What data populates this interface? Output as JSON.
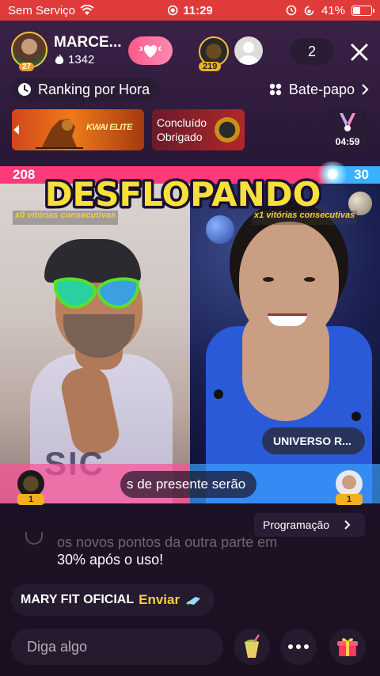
{
  "status_bar": {
    "carrier": "Sem Serviço",
    "time": "11:29",
    "battery": "41%",
    "battery_level": 0.41
  },
  "header": {
    "host_name": "MARCE...",
    "host_level": "27",
    "host_score": "1342",
    "viewer1_badge": "219",
    "viewer_count": "2"
  },
  "nav": {
    "ranking_label": "Ranking por Hora",
    "chat_label": "Bate-papo"
  },
  "banners": {
    "kwai_elite": "KWAI ELITE",
    "done_line1": "Concluído",
    "done_line2": "Obrigado",
    "pk_timer": "04:59"
  },
  "pk": {
    "left_score": "208",
    "right_score": "30",
    "left_share": 0.874,
    "title": "DESFLOPANDO",
    "left_streak": "x0 vitórias consecutivas",
    "right_streak": "x1 vitórias consecutivas",
    "left_shirt_print": "SIC",
    "opponent_name": "UNIVERSO R...",
    "left_rank": "1",
    "right_rank": "1",
    "ticker_text": "s de presente serão",
    "colors": {
      "left": "#ff3a7a",
      "right": "#3ab0ff",
      "title_fill": "#f6e03a"
    }
  },
  "chat": {
    "programacao_label": "Programação",
    "message_faded": "os novos pontos da outra parte em",
    "message_main": "30% após o uso!",
    "gift_user": "MARY FIT OFICIAL",
    "gift_send": "Enviar"
  },
  "input": {
    "placeholder": "Diga algo"
  },
  "icons": {
    "wifi": "wifi-icon",
    "lock_rotation": "rotation-lock-icon",
    "heart": "heart-wings-icon",
    "close": "close-icon",
    "clock": "clock-icon",
    "chat_grid": "chat-grid-icon",
    "chevron": "chevron-right-icon",
    "drink": "drink-icon",
    "more": "more-icon",
    "gift": "gift-icon"
  }
}
